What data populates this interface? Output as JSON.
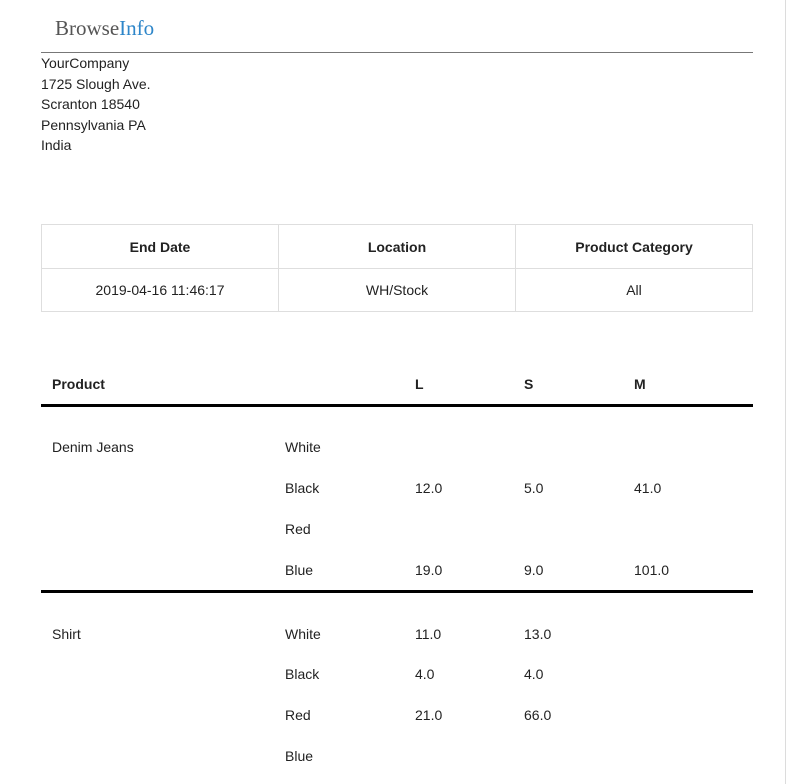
{
  "logo": {
    "part1": "Browse",
    "part2": "Info"
  },
  "company": {
    "lines": [
      "YourCompany",
      "1725 Slough Ave.",
      "Scranton 18540",
      "Pennsylvania PA",
      "India"
    ]
  },
  "filters": {
    "headers": [
      "End Date",
      "Location",
      "Product Category"
    ],
    "values": [
      "2019-04-16 11:46:17",
      "WH/Stock",
      "All"
    ]
  },
  "report": {
    "columns": {
      "product": "Product",
      "l": "L",
      "s": "S",
      "m": "M"
    },
    "groups": [
      {
        "product": "Denim Jeans",
        "rows": [
          {
            "color": "White",
            "l": "",
            "s": "",
            "m": ""
          },
          {
            "color": "Black",
            "l": "12.0",
            "s": "5.0",
            "m": "41.0"
          },
          {
            "color": "Red",
            "l": "",
            "s": "",
            "m": ""
          },
          {
            "color": "Blue",
            "l": "19.0",
            "s": "9.0",
            "m": "101.0"
          }
        ]
      },
      {
        "product": "Shirt",
        "rows": [
          {
            "color": "White",
            "l": "11.0",
            "s": "13.0",
            "m": ""
          },
          {
            "color": "Black",
            "l": "4.0",
            "s": "4.0",
            "m": ""
          },
          {
            "color": "Red",
            "l": "21.0",
            "s": "66.0",
            "m": ""
          },
          {
            "color": "Blue",
            "l": "",
            "s": "",
            "m": ""
          }
        ]
      }
    ]
  }
}
